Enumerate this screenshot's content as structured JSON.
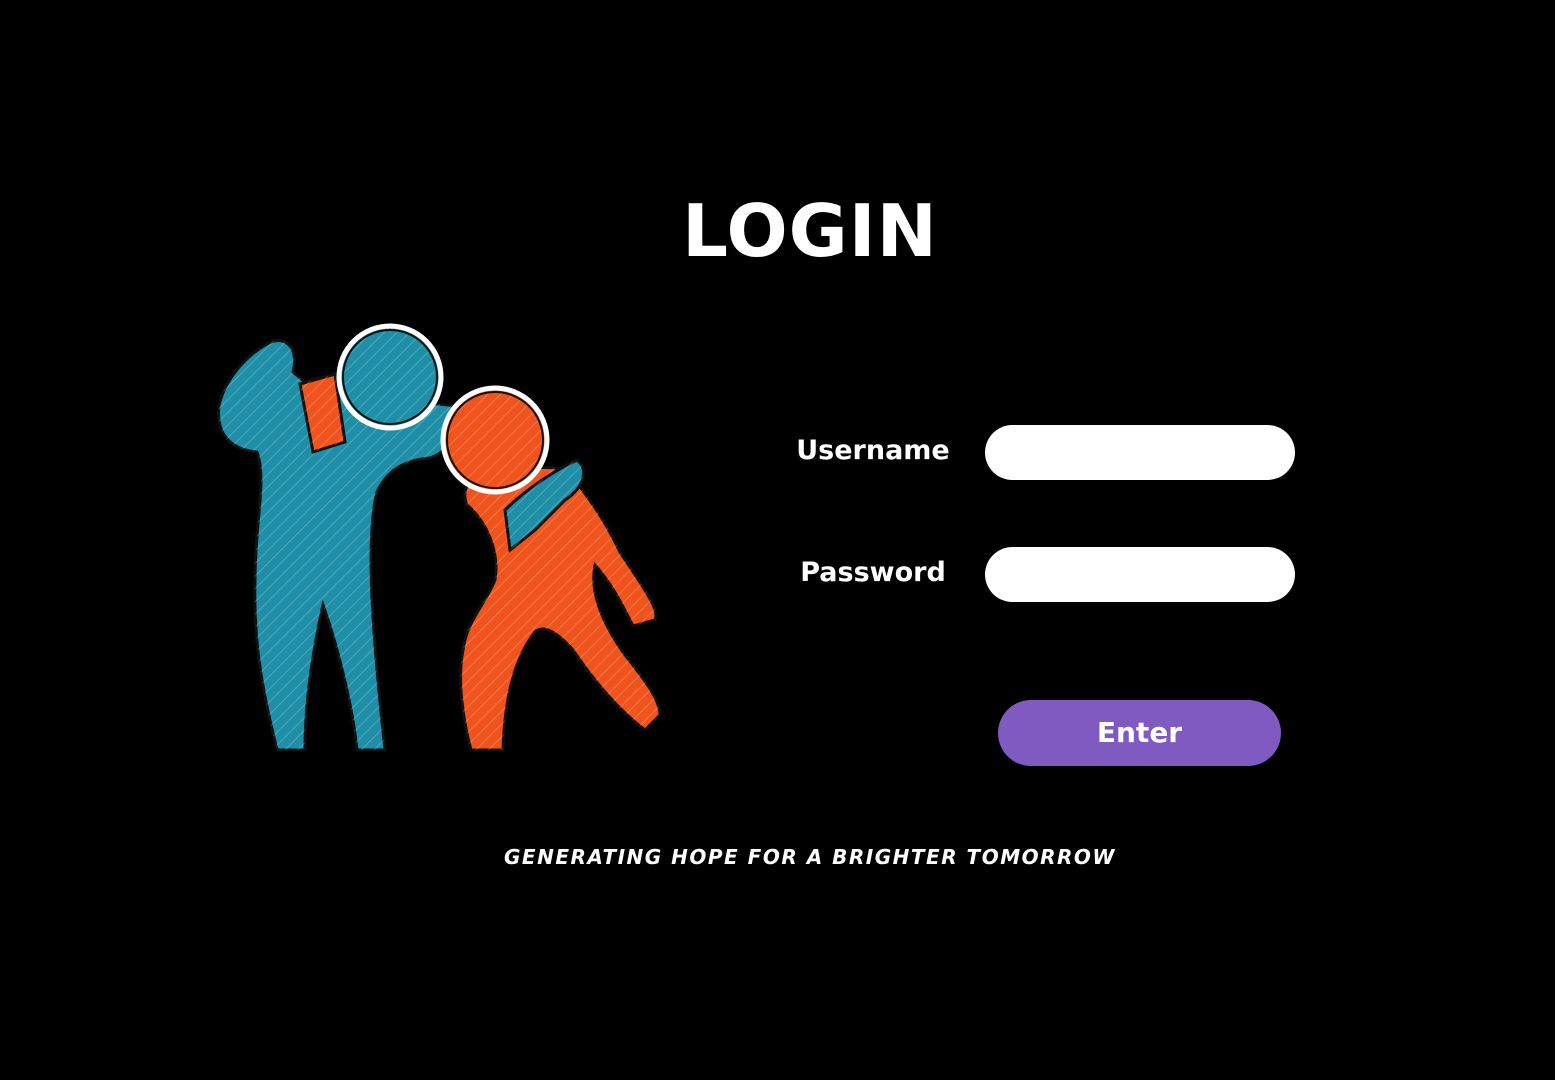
{
  "login": {
    "title": "LOGIN",
    "username_label": "Username",
    "password_label": "Password",
    "username_value": "",
    "password_value": "",
    "enter_label": "Enter"
  },
  "footer": {
    "tagline": "GENERATING HOPE FOR A BRIGHTER TOMORROW"
  },
  "illustration": {
    "icon": "two-people-supporting-icon",
    "colors": {
      "teal_figure": "#1e8fa6",
      "orange_figure": "#f0541c"
    }
  },
  "colors": {
    "background": "#000000",
    "text": "#ffffff",
    "input_background": "#ffffff",
    "button_accent": "#7f5ac0"
  }
}
